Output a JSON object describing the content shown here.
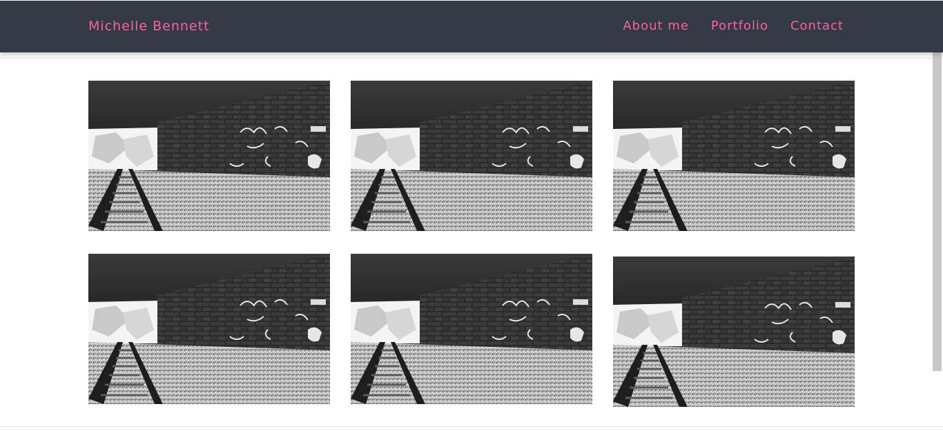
{
  "header": {
    "brand": "Michelle Bennett",
    "nav": [
      {
        "label": "About me"
      },
      {
        "label": "Portfolio"
      },
      {
        "label": "Contact"
      }
    ]
  },
  "gallery": {
    "image_subject": "railway-tunnel-photo",
    "count": 6
  },
  "colors": {
    "navbar_bg": "#343a45",
    "accent": "#ff5fa2",
    "page_bg": "#ffffff"
  }
}
